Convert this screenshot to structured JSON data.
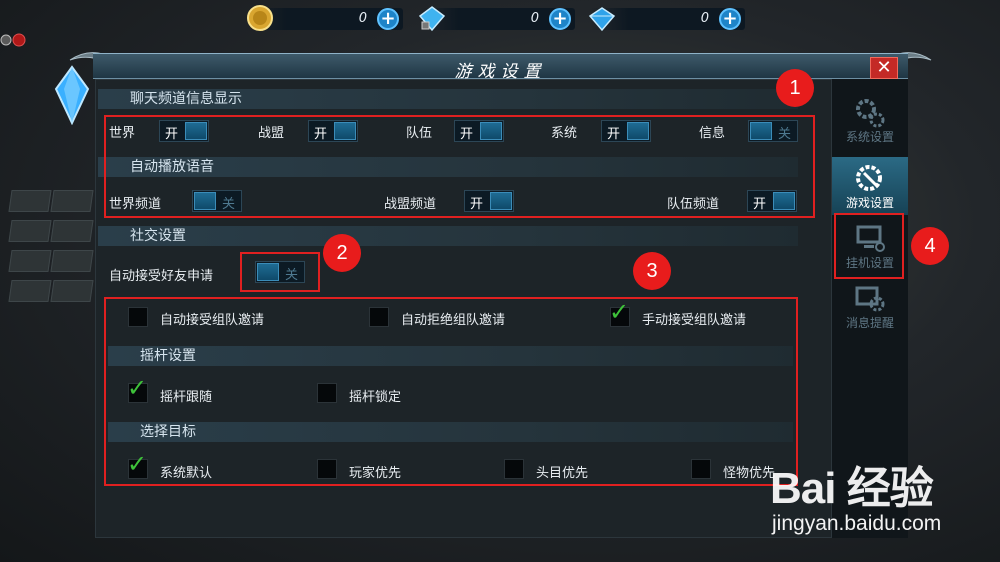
{
  "currency": [
    {
      "icon": "gold-coin-icon",
      "value": "0"
    },
    {
      "icon": "bound-diamond-icon",
      "value": "0"
    },
    {
      "icon": "diamond-icon",
      "value": "0"
    }
  ],
  "dialog": {
    "title": "游戏设置",
    "close": "✕"
  },
  "chat": {
    "heading": "聊天频道信息显示",
    "channels": [
      {
        "label": "世界",
        "state": "开"
      },
      {
        "label": "战盟",
        "state": "开"
      },
      {
        "label": "队伍",
        "state": "开"
      },
      {
        "label": "系统",
        "state": "开"
      },
      {
        "label": "信息",
        "state": "关"
      }
    ]
  },
  "voice": {
    "heading": "自动播放语音",
    "channels": [
      {
        "label": "世界频道",
        "state": "关"
      },
      {
        "label": "战盟频道",
        "state": "开"
      },
      {
        "label": "队伍频道",
        "state": "开"
      }
    ]
  },
  "social": {
    "heading": "社交设置",
    "friend_label": "自动接受好友申请",
    "friend_state": "关",
    "team_options": [
      {
        "label": "自动接受组队邀请",
        "checked": false
      },
      {
        "label": "自动拒绝组队邀请",
        "checked": false
      },
      {
        "label": "手动接受组队邀请",
        "checked": true
      }
    ]
  },
  "joystick": {
    "heading": "摇杆设置",
    "options": [
      {
        "label": "摇杆跟随",
        "checked": true
      },
      {
        "label": "摇杆锁定",
        "checked": false
      }
    ]
  },
  "target": {
    "heading": "选择目标",
    "options": [
      {
        "label": "系统默认",
        "checked": true
      },
      {
        "label": "玩家优先",
        "checked": false
      },
      {
        "label": "头目优先",
        "checked": false
      },
      {
        "label": "怪物优先",
        "checked": false
      }
    ]
  },
  "sidebar": [
    {
      "label": "系统设置",
      "icon": "gears-icon",
      "active": false
    },
    {
      "label": "游戏设置",
      "icon": "wrench-gear-icon",
      "active": true
    },
    {
      "label": "挂机设置",
      "icon": "computer-icon",
      "active": false
    },
    {
      "label": "消息提醒",
      "icon": "message-gear-icon",
      "active": false
    }
  ],
  "badges": [
    "1",
    "2",
    "3",
    "4"
  ],
  "check_mark": "✓",
  "watermark": {
    "logo": "Bai 经验",
    "url": "jingyan.baidu.com"
  },
  "colors": {
    "annotation": "#e02020",
    "accent": "#1e84c8",
    "check": "#3ec23a"
  }
}
